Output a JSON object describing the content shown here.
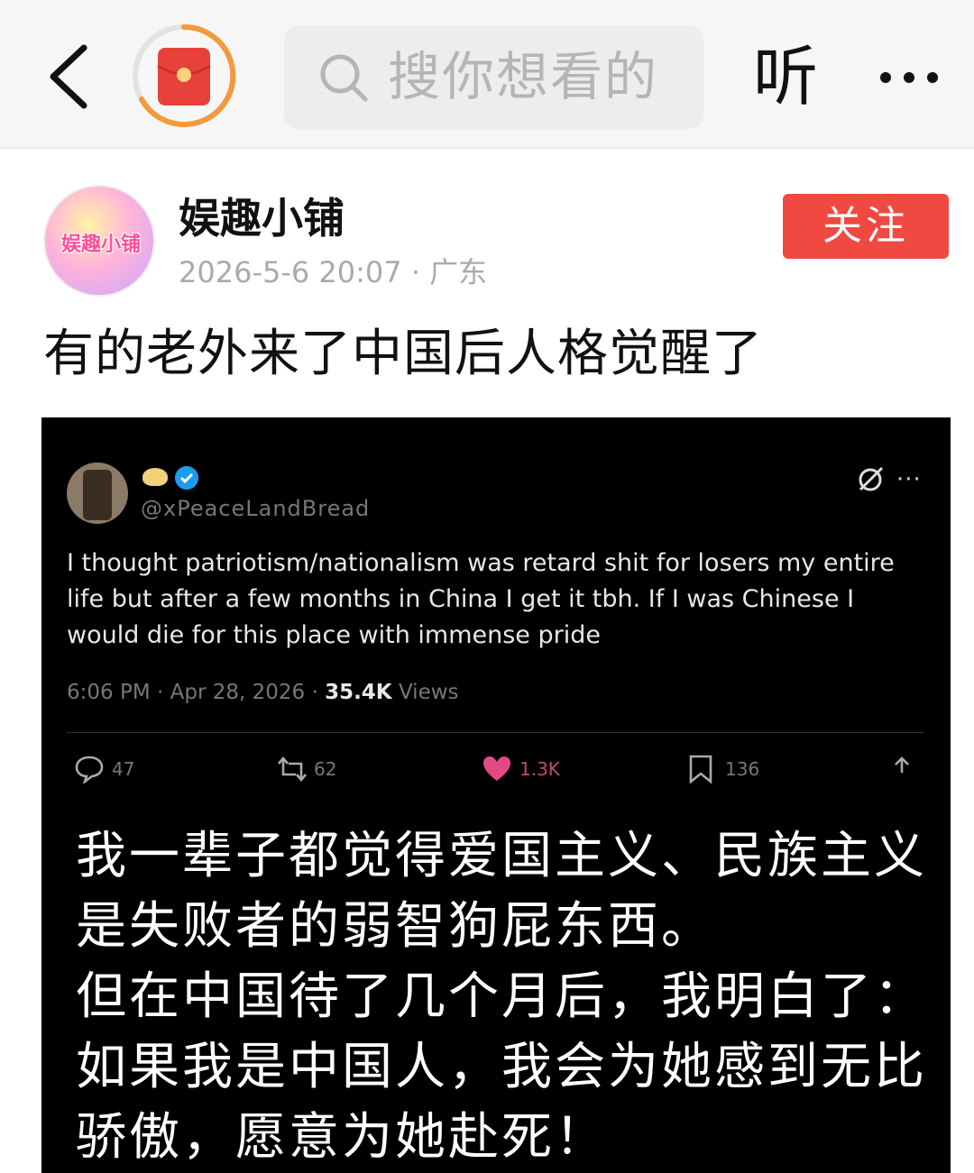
{
  "topbar": {
    "search_placeholder": "搜你想看的",
    "listen_label": "听"
  },
  "author": {
    "avatar_text": "娱趣小铺",
    "name": "娱趣小铺",
    "meta": "2026-5-6 20:07 · 广东",
    "follow_label": "关注"
  },
  "post": {
    "title": "有的老外来了中国后人格觉醒了"
  },
  "tweet": {
    "handle": "@xPeaceLandBread",
    "text": "I thought patriotism/nationalism was retard shit for losers my entire life but after a few months in China I get it tbh. If I was Chinese I would die for this place with immense pride",
    "time": "6:06 PM · Apr 28, 2026 · ",
    "views_count": "35.4K",
    "views_label": " Views",
    "replies": "47",
    "reposts": "62",
    "likes": "1.3K",
    "bookmarks": "136",
    "more_glyph": "···"
  },
  "overlay": {
    "lines": [
      "我一辈子都觉得爱国主义、民族主义",
      "是失败者的弱智狗屁东西。",
      "但在中国待了几个月后，我明白了：",
      "如果我是中国人，我会为她感到无比",
      "骄傲，愿意为她赴死！"
    ]
  },
  "colors": {
    "follow_button": "#f04942",
    "redpacket": "#e8413c",
    "redpacket_ring": "#f39a3c",
    "verified": "#1d9bf0",
    "like": "#e24a86"
  }
}
